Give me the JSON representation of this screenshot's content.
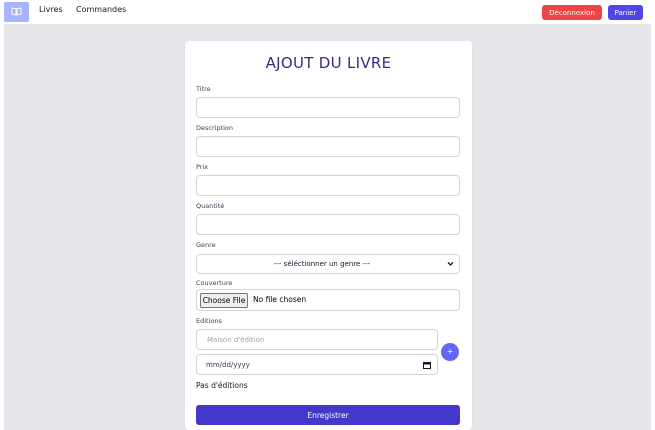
{
  "navbar": {
    "logo_icon": "book-open-icon",
    "links": [
      "Livres",
      "Commandes"
    ],
    "logout_label": "Déconnexion",
    "cart_label": "Panier",
    "colors": {
      "logout": "#ef4444",
      "cart": "#4f46e5",
      "logo_bg": "#a5b4fc"
    }
  },
  "form": {
    "title": "AJOUT DU LIVRE",
    "fields": {
      "titre": {
        "label": "Titre",
        "value": ""
      },
      "description": {
        "label": "Description",
        "value": ""
      },
      "prix": {
        "label": "Prix",
        "value": ""
      },
      "quantite": {
        "label": "Quantité",
        "value": ""
      }
    },
    "genre": {
      "label": "Genre",
      "selected": "--- séléctionner un genre ---",
      "icon": "chevron-down-icon"
    },
    "couverture": {
      "label": "Couverture",
      "button": "Choose File",
      "status": "No file chosen"
    },
    "editions": {
      "label": "Editions",
      "publisher_placeholder": "Maison d'édition",
      "date_placeholder": "mm/dd/yyyy",
      "add_label": "+",
      "empty_text": "Pas d'éditions"
    },
    "submit_label": "Enregistrer",
    "colors": {
      "title": "#312e81",
      "submit": "#4338ca",
      "add": "#6366f1"
    }
  }
}
